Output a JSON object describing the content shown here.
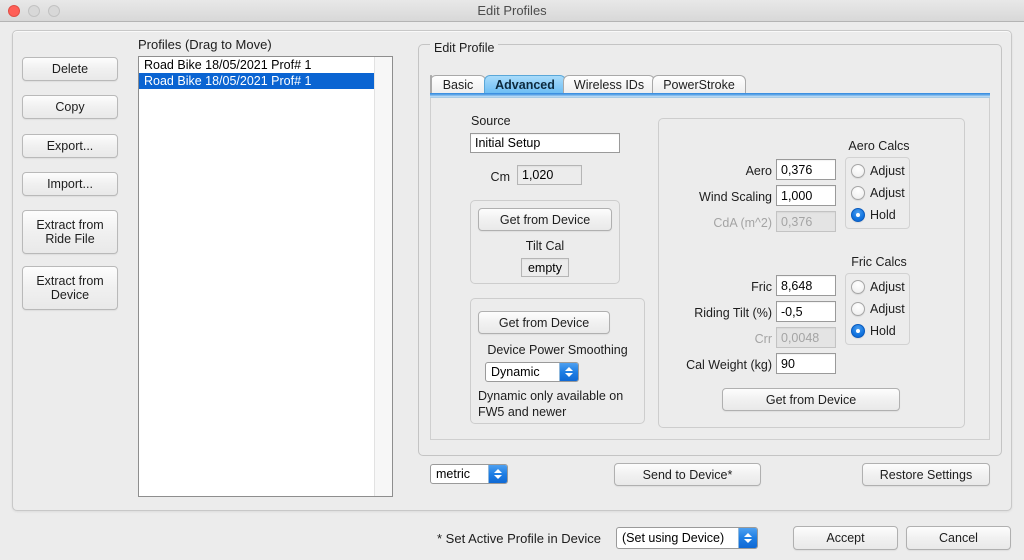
{
  "window": {
    "title": "Edit Profiles",
    "traffic_lights": [
      "close-light",
      "minimize-light",
      "zoom-light"
    ]
  },
  "sidebar": {
    "buttons": [
      {
        "label": "Delete"
      },
      {
        "label": "Copy"
      },
      {
        "label": "Export..."
      },
      {
        "label": "Import..."
      },
      {
        "label": "Extract from\nRide File",
        "line1": "Extract from",
        "line2": "Ride File"
      },
      {
        "label": "Extract from\nDevice",
        "line1": "Extract from",
        "line2": "Device"
      }
    ]
  },
  "profiles": {
    "label": "Profiles (Drag to Move)",
    "items": [
      {
        "text": "Road Bike 18/05/2021 Prof# 1",
        "selected": false
      },
      {
        "text": "Road Bike 18/05/2021 Prof# 1",
        "selected": true
      }
    ]
  },
  "edit_profile": {
    "group_title": "Edit Profile",
    "tabs": [
      {
        "label": "Basic",
        "active": false
      },
      {
        "label": "Advanced",
        "active": true
      },
      {
        "label": "Wireless IDs",
        "active": false
      },
      {
        "label": "PowerStroke",
        "active": false
      }
    ],
    "source": {
      "title": "Source",
      "value": "Initial Setup",
      "cm_label": "Cm",
      "cm_value": "1,020"
    },
    "tilt_box": {
      "get_from_device_label": "Get from Device",
      "tilt_cal_label": "Tilt Cal",
      "tilt_cal_value": "empty"
    },
    "smoothing_box": {
      "get_from_device_label": "Get from Device",
      "title": "Device Power Smoothing",
      "selected_option": "Dynamic",
      "options": [
        "Dynamic"
      ],
      "note_line1": "Dynamic only available on",
      "note_line2": "FW5 and newer"
    },
    "aero_calcs": {
      "title": "Aero Calcs",
      "rows": [
        {
          "label": "Aero",
          "value": "0,376",
          "readonly": false,
          "mode": "Adjust",
          "selected": false
        },
        {
          "label": "Wind Scaling",
          "value": "1,000",
          "readonly": false,
          "mode": "Adjust",
          "selected": false
        },
        {
          "label": "CdA (m^2)",
          "value": "0,376",
          "readonly": true,
          "mode": "Hold",
          "selected": true
        }
      ]
    },
    "fric_calcs": {
      "title": "Fric Calcs",
      "rows": [
        {
          "label": "Fric",
          "value": "8,648",
          "readonly": false,
          "mode": "Adjust",
          "selected": false
        },
        {
          "label": "Riding Tilt (%)",
          "value": "-0,5",
          "readonly": false,
          "mode": "Adjust",
          "selected": false
        },
        {
          "label": "Crr",
          "value": "0,0048",
          "readonly": true,
          "mode": "Hold",
          "selected": true
        }
      ],
      "cal_weight_label": "Cal Weight (kg)",
      "cal_weight_value": "90",
      "get_from_device_label": "Get from Device"
    },
    "units": {
      "selected_option": "metric",
      "options": [
        "metric"
      ]
    },
    "send_to_device_label": "Send to Device*",
    "restore_settings_label": "Restore Settings"
  },
  "footer": {
    "active_profile_label": "* Set Active Profile in Device",
    "active_profile_value": "(Set using Device)",
    "accept_label": "Accept",
    "cancel_label": "Cancel"
  },
  "colors": {
    "window_bg": "#ececec",
    "selection_blue": "#0a64d2",
    "accent_blue": "#1f7ee4",
    "tab_active": "#8dcdf7",
    "disabled_text": "#a4a4a4"
  }
}
